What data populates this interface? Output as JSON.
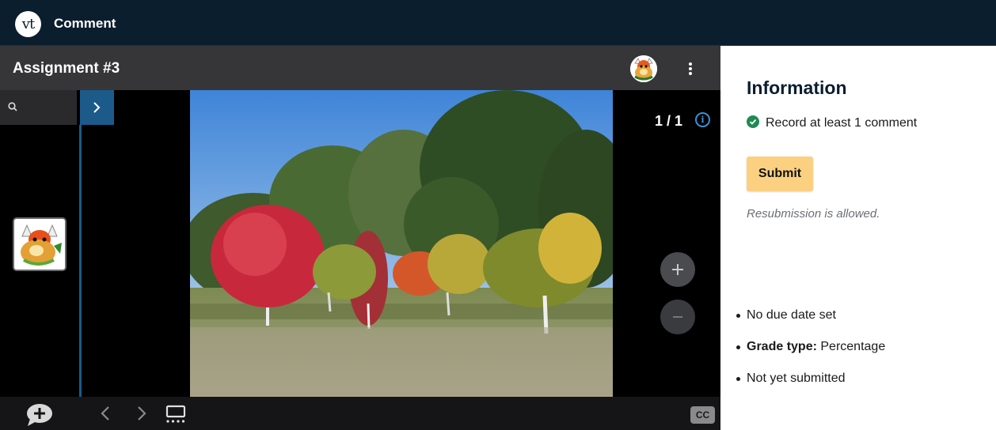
{
  "app": {
    "title": "Comment",
    "logo_text": "vt"
  },
  "viewer": {
    "title": "Assignment #3",
    "page_count": "1 / 1",
    "info_symbol": "i",
    "cc_label": "CC",
    "photo_alt": "",
    "accent_color": "#1c5a8a"
  },
  "info_panel": {
    "title": "Information",
    "requirement": "Record at least 1 comment",
    "submit_label": "Submit",
    "resubmission_note": "Resubmission is allowed.",
    "due_date": "No due date set",
    "grade_type_label": "Grade type:",
    "grade_type_value": "Percentage",
    "status": "Not yet submitted",
    "check_color": "#1f8a52",
    "submit_color": "#fbd081"
  },
  "icons": [
    "search-icon",
    "chevron-right-icon",
    "kebab-menu-icon",
    "info-icon",
    "plus-icon",
    "minus-icon",
    "add-comment-icon",
    "chevron-left-icon",
    "grid-view-icon",
    "closed-caption-icon",
    "check-circle-icon"
  ]
}
